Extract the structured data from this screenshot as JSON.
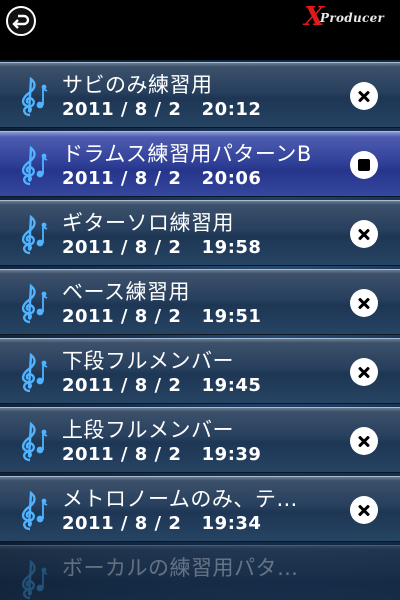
{
  "header": {
    "back_icon": "back-arrow-icon",
    "logo_x": "X",
    "logo_word": "Producer"
  },
  "recordings": [
    {
      "title": "サビのみ練習用",
      "date": "2011 / 8 / 2   20:12",
      "action": "delete",
      "active": false
    },
    {
      "title": "ドラムス練習用パターンB",
      "date": "2011 / 8 / 2   20:06",
      "action": "stop",
      "active": true
    },
    {
      "title": "ギターソロ練習用",
      "date": "2011 / 8 / 2   19:58",
      "action": "delete",
      "active": false
    },
    {
      "title": "ベース練習用",
      "date": "2011 / 8 / 2   19:51",
      "action": "delete",
      "active": false
    },
    {
      "title": "下段フルメンバー",
      "date": "2011 / 8 / 2   19:45",
      "action": "delete",
      "active": false
    },
    {
      "title": "上段フルメンバー",
      "date": "2011 / 8 / 2   19:39",
      "action": "delete",
      "active": false
    },
    {
      "title": "メトロノームのみ、テ…",
      "date": "2011 / 8 / 2   19:34",
      "action": "delete",
      "active": false
    },
    {
      "title": "ボーカルの練習用パタ…",
      "date": "",
      "action": "",
      "active": false
    }
  ],
  "colors": {
    "logo_red": "#e01a1a",
    "active_row": "#2f3f96",
    "row": "#27405e"
  }
}
